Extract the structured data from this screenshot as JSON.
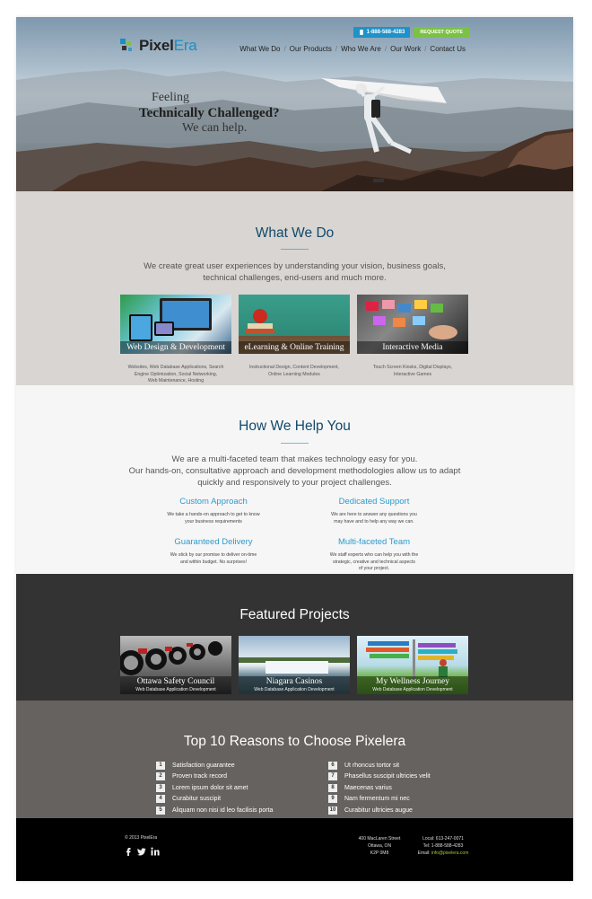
{
  "header": {
    "logo_pixel": "Pixel",
    "logo_era": "Era",
    "phone": "1-888-588-4283",
    "quote_label": "REQUEST QUOTE",
    "nav": [
      "What We Do",
      "Our Products",
      "Who We Are",
      "Our Work",
      "Contact Us"
    ]
  },
  "hero": {
    "line1": "Feeling",
    "line2": "Technically Challenged?",
    "line3": "We can help."
  },
  "what_we_do": {
    "title": "What We Do",
    "lead_1": "We create great user experiences by understanding your vision, business goals,",
    "lead_2": "technical challenges, end-users and much more.",
    "tiles": [
      {
        "caption": "Web Design & Development",
        "desc_1": "Websites, Web Database Applications, Search",
        "desc_2": "Engine Optimization, Social Networking,",
        "desc_3": "Web Maintenance, Hosting"
      },
      {
        "caption": "eLearning & Online Training",
        "desc_1": "Instructional Design, Content Development,",
        "desc_2": "Online Learning Modules",
        "desc_3": ""
      },
      {
        "caption": "Interactive Media",
        "desc_1": "Touch Screen Kiosks, Digital Displays,",
        "desc_2": "Interactive Games",
        "desc_3": ""
      }
    ]
  },
  "how_we_help": {
    "title": "How We Help You",
    "lead_1": "We are a multi-faceted team that makes technology easy for you.",
    "lead_2": "Our hands-on, consultative approach and development methodologies allow us to adapt",
    "lead_3": "quickly and responsively to your project challenges.",
    "items": [
      {
        "title": "Custom Approach",
        "text_1": "We take a hands-on approach to get to know",
        "text_2": "your business requirements",
        "text_3": ""
      },
      {
        "title": "Dedicated Support",
        "text_1": "We are here to answer any questions you",
        "text_2": "may have and to help any way we can.",
        "text_3": ""
      },
      {
        "title": "Guaranteed Delivery",
        "text_1": "We stick by our promise to deliver on-time",
        "text_2": "and within budget. No surprises!",
        "text_3": ""
      },
      {
        "title": "Multi-faceted Team",
        "text_1": "We staff experts who can help you with the",
        "text_2": "strategic, creative and technical aspects",
        "text_3": "of your project."
      }
    ]
  },
  "featured": {
    "title": "Featured Projects",
    "projects": [
      {
        "title": "Ottawa Safety Council",
        "subtitle": "Web Database Application Development"
      },
      {
        "title": "Niagara Casinos",
        "subtitle": "Web Database Application Development"
      },
      {
        "title": "My Wellness Journey",
        "subtitle": "Web Database Application Development"
      }
    ]
  },
  "reasons": {
    "title": "Top 10 Reasons to Choose Pixelera",
    "left": [
      {
        "n": "1",
        "text": "Satisfaction guarantee"
      },
      {
        "n": "2",
        "text": "Proven track record"
      },
      {
        "n": "3",
        "text": "Lorem ipsum dolor sit amet"
      },
      {
        "n": "4",
        "text": "Curabitur suscipit"
      },
      {
        "n": "5",
        "text": "Aliquam non nisi id leo facilisis porta"
      }
    ],
    "right": [
      {
        "n": "6",
        "text": "Ut rhoncus tortor sit"
      },
      {
        "n": "7",
        "text": "Phasellus suscipit ultricies velit"
      },
      {
        "n": "8",
        "text": "Maecenas varius"
      },
      {
        "n": "9",
        "text": "Nam fermentum mi nec"
      },
      {
        "n": "10",
        "text": "Curabitur ultricies augue"
      }
    ]
  },
  "footer": {
    "copyright": "© 2013 PixelEra",
    "addr_1": "400 MacLaren Street",
    "addr_2": "Ottawa, ON",
    "addr_3": "K2P 0M8",
    "local": "Local: 613-247-0071",
    "tel": "Tel: 1-888-588-4283",
    "email_label": "Email: ",
    "email": "info@pixelera.com"
  },
  "colors": {
    "brand_blue": "#1e92c9",
    "quote_green": "#7cc242",
    "heading_navy": "#124a6b",
    "help_blue": "#2a9bd0"
  },
  "icons": [
    "logo-mark-icon",
    "phone-icon",
    "facebook-icon",
    "twitter-icon",
    "linkedin-icon"
  ]
}
